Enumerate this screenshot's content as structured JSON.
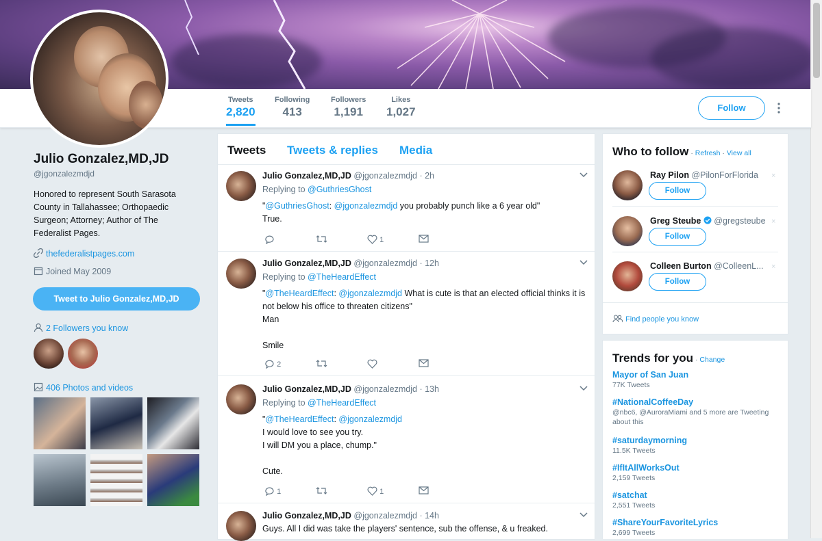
{
  "profile": {
    "name": "Julio Gonzalez,MD,JD",
    "handle": "@jgonzalezmdjd",
    "bio": "Honored to represent South Sarasota County in Tallahassee; Orthopaedic Surgeon; Attorney; Author of The Federalist Pages.",
    "website": "thefederalistpages.com",
    "joined": "Joined May 2009",
    "tweet_to_label": "Tweet to Julio Gonzalez,MD,JD",
    "followers_you_know": "2 Followers you know",
    "photos_label": "406 Photos and videos"
  },
  "stats": [
    {
      "label": "Tweets",
      "value": "2,820"
    },
    {
      "label": "Following",
      "value": "413"
    },
    {
      "label": "Followers",
      "value": "1,191"
    },
    {
      "label": "Likes",
      "value": "1,027"
    }
  ],
  "follow_label": "Follow",
  "tabs": [
    "Tweets",
    "Tweets & replies",
    "Media"
  ],
  "tweets": [
    {
      "name": "Julio Gonzalez,MD,JD",
      "handle": "@jgonzalezmdjd",
      "time": "· 2h",
      "replying_prefix": "Replying to ",
      "replying_to": "@GuthriesGhost",
      "quote_open": "\"",
      "quote_mention": "@GuthriesGhost",
      "quote_colon": ": ",
      "quote_mention2": "@jgonzalezmdjd",
      "quote_text": " you probably punch like a 6 year old\"",
      "lines": [
        "True."
      ],
      "reply_count": "",
      "like_count": "1"
    },
    {
      "name": "Julio Gonzalez,MD,JD",
      "handle": "@jgonzalezmdjd",
      "time": "· 12h",
      "replying_prefix": "Replying to ",
      "replying_to": "@TheHeardEffect",
      "quote_open": "\"",
      "quote_mention": "@TheHeardEffect",
      "quote_colon": ": ",
      "quote_mention2": "@jgonzalezmdjd",
      "quote_text": " What is cute is that an elected official thinks it is not below his office to threaten citizens\"",
      "lines": [
        "Man",
        "",
        "Smile"
      ],
      "reply_count": "2",
      "like_count": ""
    },
    {
      "name": "Julio Gonzalez,MD,JD",
      "handle": "@jgonzalezmdjd",
      "time": "· 13h",
      "replying_prefix": "Replying to ",
      "replying_to": "@TheHeardEffect",
      "quote_open": "\"",
      "quote_mention": "@TheHeardEffect",
      "quote_colon": ": ",
      "quote_mention2": "@jgonzalezmdjd",
      "quote_text": "",
      "lines": [
        "I would love to see you try.",
        "I will DM you a place, chump.\"",
        "",
        "Cute."
      ],
      "reply_count": "1",
      "like_count": "1"
    },
    {
      "name": "Julio Gonzalez,MD,JD",
      "handle": "@jgonzalezmdjd",
      "time": "· 14h",
      "text": "Guys. All I did was take the players' sentence, sub the offense, & u freaked."
    }
  ],
  "who_to_follow": {
    "title": "Who to follow",
    "refresh": "Refresh",
    "view_all": "View all",
    "sep": " · ",
    "users": [
      {
        "name": "Ray Pilon",
        "handle": "@PilonForFlorida",
        "verified": false
      },
      {
        "name": "Greg Steube",
        "handle": "@gregsteube",
        "verified": true
      },
      {
        "name": "Colleen Burton",
        "handle": "@ColleenL...",
        "verified": false
      }
    ],
    "find_people": "Find people you know",
    "follow_label": "Follow",
    "dismiss": "×"
  },
  "trends": {
    "title": "Trends for you",
    "change": "Change",
    "items": [
      {
        "name": "Mayor of San Juan",
        "sub": "77K Tweets"
      },
      {
        "name": "#NationalCoffeeDay",
        "sub": "@nbc6, @AuroraMiami and 5 more are Tweeting about this"
      },
      {
        "name": "#saturdaymorning",
        "sub": "11.5K Tweets"
      },
      {
        "name": "#IfItAllWorksOut",
        "sub": "2,159 Tweets"
      },
      {
        "name": "#satchat",
        "sub": "2,551 Tweets"
      },
      {
        "name": "#ShareYourFavoriteLyrics",
        "sub": "2,699 Tweets"
      }
    ]
  },
  "colors": {
    "accent": "#1da1f2",
    "link": "#1b95e0",
    "muted": "#657786"
  }
}
